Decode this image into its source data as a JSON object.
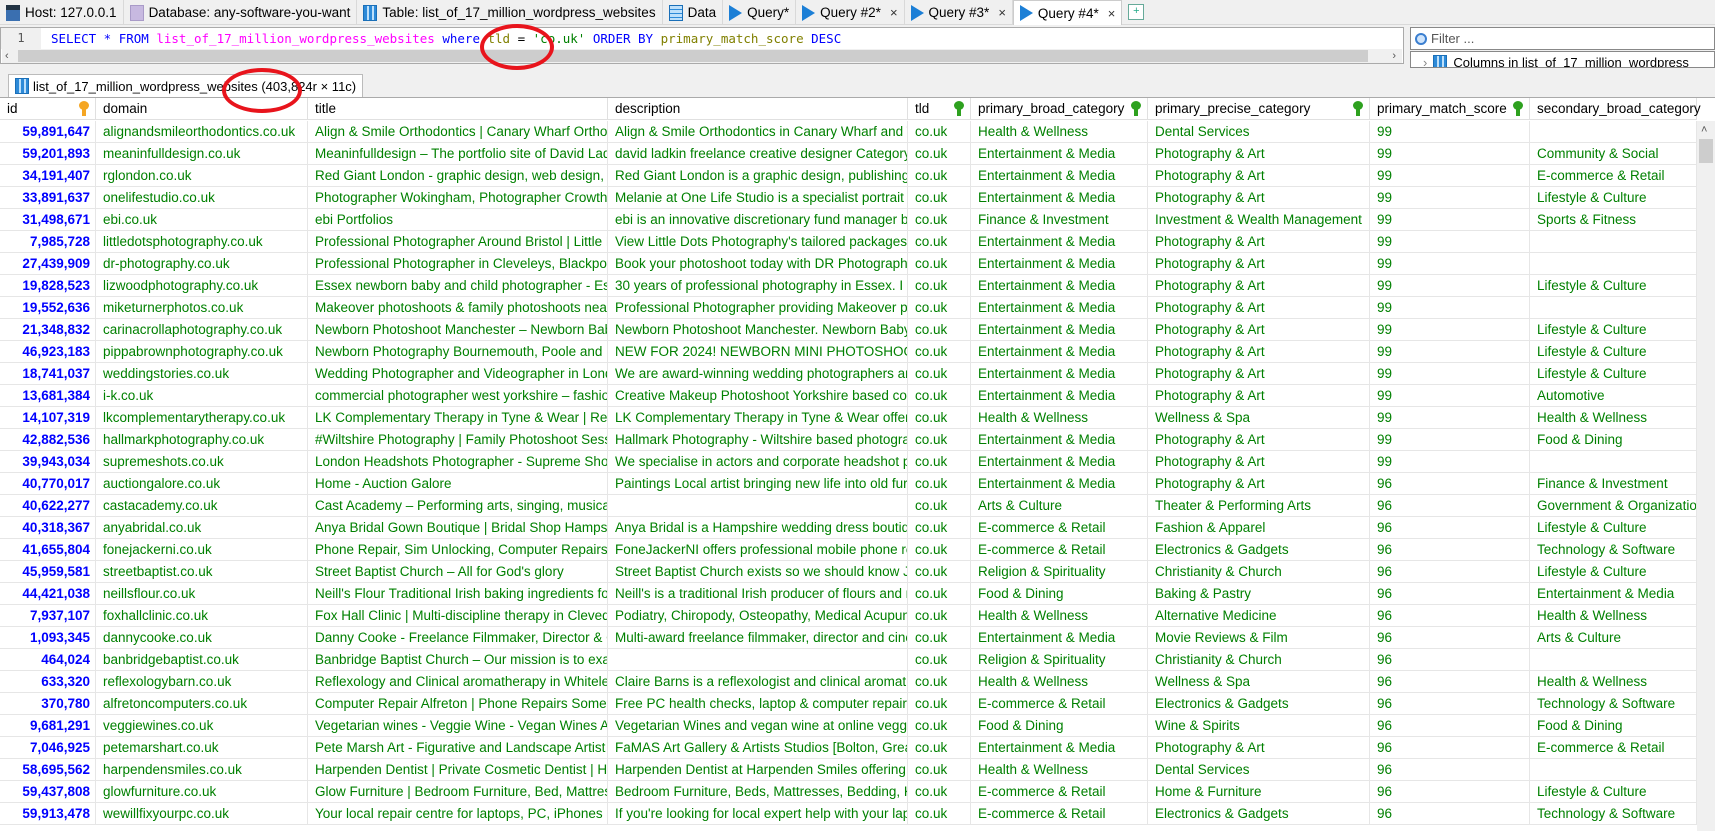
{
  "tabs": [
    {
      "label": "Host: 127.0.0.1",
      "icon": "host-icon"
    },
    {
      "label": "Database: any-software-you-want",
      "icon": "database-icon"
    },
    {
      "label": "Table: list_of_17_million_wordpress_websites",
      "icon": "table-icon"
    },
    {
      "label": "Data",
      "icon": "data-grid-icon"
    },
    {
      "label": "Query*",
      "icon": "query-play-icon"
    },
    {
      "label": "Query #2*",
      "icon": "query-play-icon",
      "closable": true
    },
    {
      "label": "Query #3*",
      "icon": "query-play-icon",
      "closable": true
    },
    {
      "label": "Query #4*",
      "icon": "query-play-icon",
      "closable": true,
      "active": true
    }
  ],
  "close_glyph": "×",
  "editor": {
    "line_number": "1",
    "sql": {
      "select": "SELECT * FROM ",
      "table": "list_of_17_million_wordpress_websites",
      "where": " where ",
      "col": "tld",
      "eq": " = ",
      "str": "'co.uk'",
      "order": " ORDER BY ",
      "col2": "primary_match_score",
      "desc": " DESC"
    }
  },
  "filter": {
    "placeholder": "Filter ...",
    "tree_item": "Columns in list_of_17_million_wordpress"
  },
  "result_tab": {
    "label": "list_of_17_million_wordpress_websites (403,824r × 11c)"
  },
  "colors": {
    "id": "#0000ff",
    "text": "#008000",
    "pk_key": "#f5a623",
    "index_key": "#2ea11f",
    "annotation": "#e8141c"
  },
  "columns": [
    {
      "name": "id",
      "key": "primary"
    },
    {
      "name": "domain"
    },
    {
      "name": "title"
    },
    {
      "name": "description"
    },
    {
      "name": "tld",
      "key": "index"
    },
    {
      "name": "primary_broad_category",
      "key": "index"
    },
    {
      "name": "primary_precise_category",
      "key": "index"
    },
    {
      "name": "primary_match_score",
      "key": "index"
    },
    {
      "name": "secondary_broad_category"
    }
  ],
  "rows": [
    [
      "59,891,647",
      "alignandsmileorthodontics.co.uk",
      "Align & Smile Orthodontics | Canary Wharf Orthodo...",
      "Align & Smile Orthodontics in Canary Wharf and To...",
      "co.uk",
      "Health & Wellness",
      "Dental Services",
      "99",
      ""
    ],
    [
      "59,201,893",
      "meaninfulldesign.co.uk",
      "Meaninfulldesign – The portfolio site of David Ladkin",
      "david ladkin freelance creative designer Category:All...",
      "co.uk",
      "Entertainment & Media",
      "Photography & Art",
      "99",
      "Community & Social"
    ],
    [
      "34,191,407",
      "rglondon.co.uk",
      "Red Giant London - graphic design, web design, pu...",
      "Red Giant London is a graphic design, publishing & ...",
      "co.uk",
      "Entertainment & Media",
      "Photography & Art",
      "99",
      "E-commerce & Retail"
    ],
    [
      "33,891,637",
      "onelifestudio.co.uk",
      "Photographer Wokingham, Photographer Crowthor...",
      "Melanie at One Life Studio is a specialist portrait pho...",
      "co.uk",
      "Entertainment & Media",
      "Photography & Art",
      "99",
      "Lifestyle & Culture"
    ],
    [
      "31,498,671",
      "ebi.co.uk",
      "ebi Portfolios",
      "ebi is an innovative discretionary fund manager buil...",
      "co.uk",
      "Finance & Investment",
      "Investment & Wealth Management",
      "99",
      "Sports & Fitness"
    ],
    [
      "7,985,728",
      "littledotsphotography.co.uk",
      "Professional Photographer Around Bristol | Little Dot...",
      "View Little Dots Photography's tailored packages an...",
      "co.uk",
      "Entertainment & Media",
      "Photography & Art",
      "99",
      ""
    ],
    [
      "27,439,909",
      "dr-photography.co.uk",
      "Professional Photographer in Cleveleys, Blackpool",
      "Book your photoshoot today with DR Photography ...",
      "co.uk",
      "Entertainment & Media",
      "Photography & Art",
      "99",
      ""
    ],
    [
      "19,828,523",
      "lizwoodphotography.co.uk",
      "Essex newborn baby and child photographer - Essex...",
      "30 years of professional photography in Essex. I am ...",
      "co.uk",
      "Entertainment & Media",
      "Photography & Art",
      "99",
      "Lifestyle & Culture"
    ],
    [
      "19,552,636",
      "miketurnerphotos.co.uk",
      "Makeover photoshoots & family photoshoots near ...",
      "Professional Photographer providing Makeover pho...",
      "co.uk",
      "Entertainment & Media",
      "Photography & Art",
      "99",
      ""
    ],
    [
      "21,348,832",
      "carinacrollaphotography.co.uk",
      "Newborn Photoshoot Manchester – Newborn Baby ...",
      "Newborn Photoshoot Manchester. Newborn Baby P...",
      "co.uk",
      "Entertainment & Media",
      "Photography & Art",
      "99",
      "Lifestyle & Culture"
    ],
    [
      "46,923,183",
      "pippabrownphotography.co.uk",
      "Newborn Photography Bournemouth, Poole and Do...",
      "  NEW FOR 2024! NEWBORN MINI PHOTOSHOOTS! ...",
      "co.uk",
      "Entertainment & Media",
      "Photography & Art",
      "99",
      "Lifestyle & Culture"
    ],
    [
      "18,741,037",
      "weddingstories.co.uk",
      "Wedding Photographer and Videographer in Londo...",
      "We are award-winning wedding photographers and ...",
      "co.uk",
      "Entertainment & Media",
      "Photography & Art",
      "99",
      "Lifestyle & Culture"
    ],
    [
      "13,681,384",
      "i-k.co.uk",
      "commercial photographer west yorkshire – fashion ...",
      "Creative Makeup Photoshoot Yorkshire based com...",
      "co.uk",
      "Entertainment & Media",
      "Photography & Art",
      "99",
      "Automotive"
    ],
    [
      "14,107,319",
      "lkcomplementarytherapy.co.uk",
      "LK Complementary Therapy in Tyne & Wear |  Reflex...",
      "LK Complementary Therapy in Tyne & Wear offer Re...",
      "co.uk",
      "Health & Wellness",
      "Wellness & Spa",
      "99",
      "Health & Wellness"
    ],
    [
      "42,882,536",
      "hallmarkphotography.co.uk",
      "#Wiltshire Photography | Family Photoshoot Sessions",
      "Hallmark Photography - Wiltshire based photograp...",
      "co.uk",
      "Entertainment & Media",
      "Photography & Art",
      "99",
      "Food & Dining"
    ],
    [
      "39,943,034",
      "supremeshots.co.uk",
      "London Headshots Photographer - Supreme Shots -...",
      "We specialise in actors and corporate headshot phot...",
      "co.uk",
      "Entertainment & Media",
      "Photography & Art",
      "99",
      ""
    ],
    [
      "40,770,017",
      "auctiongalore.co.uk",
      "Home - Auction Galore",
      "Paintings Local artist bringing new life into old furni...",
      "co.uk",
      "Entertainment & Media",
      "Photography & Art",
      "96",
      "Finance & Investment"
    ],
    [
      "40,622,277",
      "castacademy.co.uk",
      "Cast Academy – Performing arts, singing, musical th...",
      "",
      "co.uk",
      "Arts & Culture",
      "Theater & Performing Arts",
      "96",
      "Government & Organizations"
    ],
    [
      "40,318,367",
      "anyabridal.co.uk",
      "Anya Bridal Gown Boutique | Bridal Shop Hampshire...",
      "Anya Bridal is a Hampshire wedding dress boutique,...",
      "co.uk",
      "E-commerce & Retail",
      "Fashion & Apparel",
      "96",
      "Lifestyle & Culture"
    ],
    [
      "41,655,804",
      "fonejackerni.co.uk",
      "Phone Repair, Sim Unlocking, Computer Repairs | Fo...",
      "FoneJackerNI offers professional mobile phone repai...",
      "co.uk",
      "E-commerce & Retail",
      "Electronics & Gadgets",
      "96",
      "Technology & Software"
    ],
    [
      "45,959,581",
      "streetbaptist.co.uk",
      "Street Baptist Church – All for God's glory",
      "Street Baptist Church exists so we should know Jesu...",
      "co.uk",
      "Religion & Spirituality",
      "Christianity & Church",
      "96",
      "Lifestyle & Culture"
    ],
    [
      "44,421,038",
      "neillsflour.co.uk",
      "Neill's Flour Traditional Irish baking ingredients for b...",
      "Neill's is a traditional Irish producer of flours and mi...",
      "co.uk",
      "Food & Dining",
      "Baking & Pastry",
      "96",
      "Entertainment & Media"
    ],
    [
      "7,937,107",
      "foxhallclinic.co.uk",
      "Fox Hall Clinic | Multi-discipline therapy in Clevedo...",
      "Podiatry, Chiropody, Osteopathy, Medical Acupunct...",
      "co.uk",
      "Health & Wellness",
      "Alternative Medicine",
      "96",
      "Health & Wellness"
    ],
    [
      "1,093,345",
      "dannycooke.co.uk",
      "Danny Cooke - Freelance Filmmaker, Director & Cin...",
      "Multi-award freelance filmmaker, director and cine...",
      "co.uk",
      "Entertainment & Media",
      "Movie Reviews & Film",
      "96",
      "Arts & Culture"
    ],
    [
      "464,024",
      "banbridgebaptist.co.uk",
      "Banbridge Baptist Church – Our mission is to exalt t...",
      "",
      "co.uk",
      "Religion & Spirituality",
      "Christianity & Church",
      "96",
      ""
    ],
    [
      "633,320",
      "reflexologybarn.co.uk",
      "Reflexology and Clinical aromatherapy in Whiteley, ...",
      "Claire Barns is a reflexologist and clinical aromather...",
      "co.uk",
      "Health & Wellness",
      "Wellness & Spa",
      "96",
      "Health & Wellness"
    ],
    [
      "370,780",
      "alfretoncomputers.co.uk",
      "Computer Repair Alfreton | Phone Repairs Somercotes",
      "Free PC health checks, laptop & computer repair, iP...",
      "co.uk",
      "E-commerce & Retail",
      "Electronics & Gadgets",
      "96",
      "Technology & Software"
    ],
    [
      "9,681,291",
      "veggiewines.co.uk",
      "Vegetarian wines - Veggie Wine - Vegan Wines And ...",
      "Vegetarian Wines and vegan wine at online veggie w...",
      "co.uk",
      "Food & Dining",
      "Wine & Spirits",
      "96",
      "Food & Dining"
    ],
    [
      "7,046,925",
      "petemarshart.co.uk",
      "Pete Marsh Art - Figurative and Landscape Artist",
      "FaMAS Art Gallery & Artists Studios [Bolton, Greater ...",
      "co.uk",
      "Entertainment & Media",
      "Photography & Art",
      "96",
      "E-commerce & Retail"
    ],
    [
      "58,695,562",
      "harpendensmiles.co.uk",
      "Harpenden Dentist | Private Cosmetic Dentist | Harp...",
      "Harpenden Dentist at Harpenden Smiles offering de...",
      "co.uk",
      "Health & Wellness",
      "Dental Services",
      "96",
      ""
    ],
    [
      "59,437,808",
      "glowfurniture.co.uk",
      "Glow Furniture | Bedroom Furniture, Bed, Mattress, ...",
      "Bedroom Furniture, Beds, Mattresses, Bedding, Kids ...",
      "co.uk",
      "E-commerce & Retail",
      "Home & Furniture",
      "96",
      "Lifestyle & Culture"
    ],
    [
      "59,913,478",
      "wewillfixyourpc.co.uk",
      "Your local repair centre for laptops, PC, iPhones and...",
      "If you're looking for local expert help with your lapt...",
      "co.uk",
      "E-commerce & Retail",
      "Electronics & Gadgets",
      "96",
      "Technology & Software"
    ]
  ]
}
